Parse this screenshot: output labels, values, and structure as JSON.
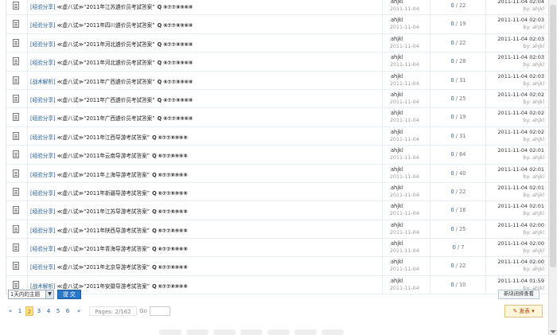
{
  "threads": [
    {
      "category": "[经验分享]",
      "title": "≪虚八试≫“2011年江苏遴价员考試答案”",
      "mark": "Q ⑥⑦⑦⑧⑨⑥⑧",
      "author": "ahjkl",
      "date": "2011-11-04",
      "replies": "0",
      "views": "22",
      "last_time": "2011-11-04 02:04",
      "last_by": "by: ahjkl"
    },
    {
      "category": "[经验分享]",
      "title": "≪虚八试≫“2011年四川遴价员考試答案”",
      "mark": "Q ⑥⑦⑦⑧⑨⑥⑧",
      "author": "ahjkl",
      "date": "2011-11-04",
      "replies": "0",
      "views": "19",
      "last_time": "2011-11-04 02:03",
      "last_by": "by: ahjkl"
    },
    {
      "category": "[经验分享]",
      "title": "≪虚八试≫“2011年河北遴价员考試答案”",
      "mark": "Q ⑥⑦⑦⑧⑨⑥⑧",
      "author": "ahjkl",
      "date": "2011-11-04",
      "replies": "0",
      "views": "22",
      "last_time": "2011-11-04 02:03",
      "last_by": "by: ahjkl"
    },
    {
      "category": "[经验分享]",
      "title": "≪虚八试≫“2011年河北遴价员考試答案”",
      "mark": "Q ⑥⑦⑦⑧⑨⑥⑧",
      "author": "ahjkl",
      "date": "2011-11-04",
      "replies": "0",
      "views": "28",
      "last_time": "2011-11-04 02:03",
      "last_by": "by: ahjkl"
    },
    {
      "category": "[战术解析]",
      "title": "≪虚八试≫“2011年广西遴价员考試答案”",
      "mark": "Q ⑥⑦⑦⑧⑨⑥⑧",
      "author": "ahjkl",
      "date": "2011-11-04",
      "replies": "0",
      "views": "31",
      "last_time": "2011-11-04 02:03",
      "last_by": "by: ahjkl"
    },
    {
      "category": "[经验分享]",
      "title": "≪虚八试≫“2011年广西遴价员考試答案”",
      "mark": "Q ⑥⑦⑦⑧⑨⑥⑧",
      "author": "ahjkl",
      "date": "2011-11-04",
      "replies": "0",
      "views": "25",
      "last_time": "2011-11-04 02:02",
      "last_by": "by: ahjkl"
    },
    {
      "category": "[经验分享]",
      "title": "≪虚八试≫“2011年广西遴价员考試答案”",
      "mark": "Q ⑥⑦⑦⑧⑨⑥⑧",
      "author": "ahjkl",
      "date": "2011-11-04",
      "replies": "0",
      "views": "19",
      "last_time": "2011-11-04 02:02",
      "last_by": "by: ahjkl"
    },
    {
      "category": "[经验分享]",
      "title": "≪虚八试≫“2011年江西导游考試答案”",
      "mark": "Q ⑥⑦⑦⑧⑨⑥⑧",
      "author": "ahjkl",
      "date": "2011-11-04",
      "replies": "0",
      "views": "31",
      "last_time": "2011-11-04 02:02",
      "last_by": "by: ahjkl"
    },
    {
      "category": "[经验分享]",
      "title": "≪虚八试≫“2011年云南导游考試答案”",
      "mark": "Q ⑥⑦⑦⑧⑨⑥⑧",
      "author": "ahjkl",
      "date": "2011-11-04",
      "replies": "0",
      "views": "64",
      "last_time": "2011-11-04 02:01",
      "last_by": "by: ahjkl"
    },
    {
      "category": "[经验分享]",
      "title": "≪虚八试≫“2011年上海导游考試答案”",
      "mark": "Q ⑥⑦⑦⑧⑨⑥⑧",
      "author": "ahjkl",
      "date": "2011-11-04",
      "replies": "0",
      "views": "40",
      "last_time": "2011-11-04 02:01",
      "last_by": "by: ahjkl"
    },
    {
      "category": "[经验分享]",
      "title": "≪虚八试≫“2011年新疆导游考試答案”",
      "mark": "Q ⑥⑦⑦⑧⑨⑥⑧",
      "author": "ahjkl",
      "date": "2011-11-04",
      "replies": "0",
      "views": "22",
      "last_time": "2011-11-04 02:01",
      "last_by": "by: ahjkl"
    },
    {
      "category": "[经验分享]",
      "title": "≪虚八试≫“2011年江苏导游考試答案”",
      "mark": "Q ⑥⑦⑦⑧⑨⑥⑧",
      "author": "ahjkl",
      "date": "2011-11-04",
      "replies": "0",
      "views": "16",
      "last_time": "2011-11-04 02:01",
      "last_by": "by: ahjkl"
    },
    {
      "category": "[经验分享]",
      "title": "≪虚八试≫“2011年陕西导游考試答案”",
      "mark": "Q ⑥⑦⑦⑧⑨⑥⑧",
      "author": "ahjkl",
      "date": "2011-11-04",
      "replies": "0",
      "views": "25",
      "last_time": "2011-11-04 02:00",
      "last_by": "by: ahjkl"
    },
    {
      "category": "[经验分享]",
      "title": "≪虚八试≫“2011年青海导游考試答案”",
      "mark": "Q ⑥⑦⑦⑧⑨⑥⑧",
      "author": "ahjkl",
      "date": "2011-11-04",
      "replies": "0",
      "views": "7",
      "last_time": "2011-11-04 02:00",
      "last_by": "by: ahjkl"
    },
    {
      "category": "[经验分享]",
      "title": "≪虚八试≫“2011年北京导游考試答案”",
      "mark": "Q ⑥⑦⑦⑧⑨⑥⑧",
      "author": "ahjkl",
      "date": "2011-11-04",
      "replies": "0",
      "views": "22",
      "last_time": "2011-11-04 02:00",
      "last_by": "by: ahjkl"
    },
    {
      "category": "[战术解析]",
      "title": "≪虚八试≫“2011年安徽导游考試答案”",
      "mark": "Q ⑥⑦⑦⑧⑨⑥⑧",
      "author": "ahjkl",
      "date": "2011-11-04",
      "replies": "0",
      "views": "10",
      "last_time": "2011-11-04 01:59",
      "last_by": "by: ahjkl"
    }
  ],
  "toolbar": {
    "filter_value": "1天内的主题",
    "submit_label": "提 交",
    "new_window_label": "新块闭择查看"
  },
  "pager": {
    "first": "«",
    "pages": [
      "1",
      "2",
      "3",
      "4",
      "5",
      "6"
    ],
    "current": "2",
    "last": "»",
    "info": "Pages: 2/162",
    "go_label": "Go"
  },
  "post_button": {
    "label": "✎ 发表 ▾"
  },
  "colors": {
    "link": "#1e5a9a",
    "current_page_bg": "#ffe28a",
    "submit_bg": "#2a78c8"
  }
}
